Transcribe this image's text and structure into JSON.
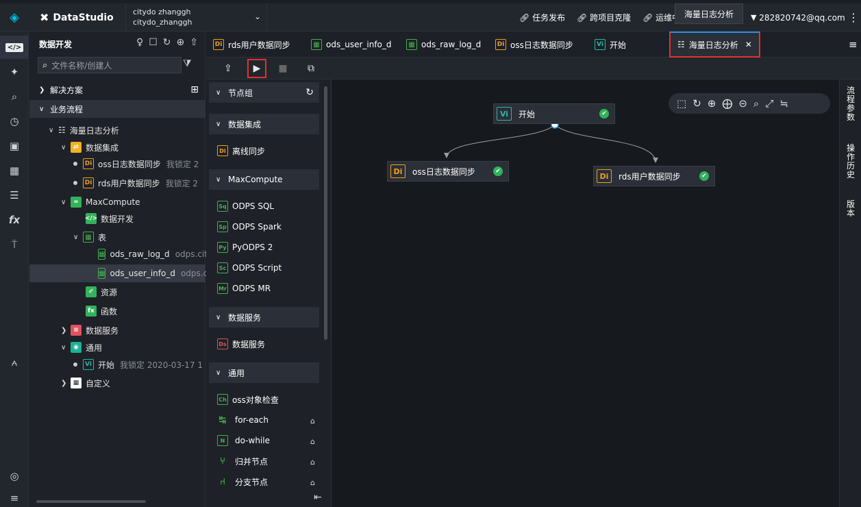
{
  "topbar": {
    "brand": "DataStudio",
    "workspace_line1": "citydo zhanggh",
    "workspace_line2": "citydo_zhanggh",
    "links": [
      "任务发布",
      "跨项目克隆",
      "运维中"
    ],
    "tooltip": "海量日志分析",
    "user": "282820742@qq.com"
  },
  "side": {
    "title": "数据开发",
    "search_placeholder": "文件名称/创建人",
    "sections": {
      "solutions": "解决方案",
      "business_flow": "业务流程"
    },
    "tree": {
      "flow": "海量日志分析",
      "data_integration": "数据集成",
      "oss_sync": "oss日志数据同步",
      "oss_sync_meta": "我锁定 2",
      "rds_sync": "rds用户数据同步",
      "rds_sync_meta": "我锁定 2",
      "maxcompute": "MaxCompute",
      "data_dev": "数据开发",
      "table": "表",
      "raw_log": "ods_raw_log_d",
      "raw_log_meta": "odps.city",
      "user_info": "ods_user_info_d",
      "user_info_meta": "odps.ci",
      "resource": "资源",
      "function": "函数",
      "data_service": "数据服务",
      "general": "通用",
      "start": "开始",
      "start_meta": "我锁定  2020-03-17 1",
      "custom": "自定义"
    }
  },
  "tabs": [
    "rds用户数据同步",
    "ods_user_info_d",
    "ods_raw_log_d",
    "oss日志数据同步",
    "开始",
    "海量日志分析"
  ],
  "palette": {
    "groups": {
      "node_group": "节点组",
      "integration": "数据集成",
      "maxcompute": "MaxCompute",
      "service": "数据服务",
      "general": "通用"
    },
    "items": {
      "offline_sync": "离线同步",
      "odps_sql": "ODPS SQL",
      "odps_spark": "ODPS Spark",
      "pyodps": "PyODPS 2",
      "odps_script": "ODPS Script",
      "odps_mr": "ODPS MR",
      "data_service": "数据服务",
      "oss_check": "oss对象检查",
      "for_each": "for-each",
      "do_while": "do-while",
      "merge": "归并节点",
      "branch": "分支节点"
    }
  },
  "canvas": {
    "start_node": "开始",
    "oss_node": "oss日志数据同步",
    "rds_node": "rds用户数据同步"
  },
  "right_strip": [
    "流程参数",
    "操作历史",
    "版本"
  ]
}
